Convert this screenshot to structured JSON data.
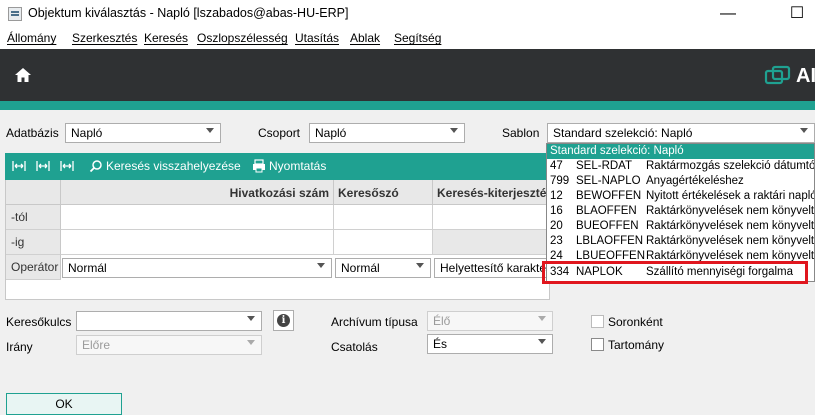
{
  "window": {
    "title": "Objektum kiválasztás - Napló  [lszabados@abas-HU-ERP]",
    "minimize": "—",
    "maximize": "☐"
  },
  "menu": [
    "Állomány",
    "Szerkesztés",
    "Keresés",
    "Oszlopszélesség",
    "Utasítás",
    "Ablak",
    "Segítség"
  ],
  "brand": {
    "text": "AI",
    "accent": "#1fa191"
  },
  "form": {
    "adatbazis_label": "Adatbázis",
    "adatbazis_value": "Napló",
    "csoport_label": "Csoport",
    "csoport_value": "Napló",
    "sablon_label": "Sablon",
    "sablon_value": "Standard szelekció: Napló"
  },
  "toolbar": {
    "search_reset": "Keresés visszahelyezése",
    "print": "Nyomtatás"
  },
  "grid": {
    "headers": [
      "Hivatkozási szám",
      "Keresőszó",
      "Keresés-kiterjeszté"
    ],
    "rows": [
      "-tól",
      "-ig",
      "Operátor"
    ],
    "operators": [
      "Normál",
      "Normál",
      "Helyettesítő karakte"
    ]
  },
  "dropdown": {
    "selected": "Standard szelekció: Napló",
    "items": [
      {
        "num": "47",
        "code": "SEL-RDAT",
        "desc": "Raktármozgás szelekció dátumtól"
      },
      {
        "num": "799",
        "code": "SEL-NAPLO",
        "desc": "Anyagértékeléshez"
      },
      {
        "num": "12",
        "code": "BEWOFFEN",
        "desc": "Nyitott értékelések a raktári napló"
      },
      {
        "num": "16",
        "code": "BLAOFFEN",
        "desc": "Raktárkönyvelések nem könyvelt"
      },
      {
        "num": "20",
        "code": "BUEOFFEN",
        "desc": "Raktárkönyvelések nem könyvelt"
      },
      {
        "num": "23",
        "code": "LBLAOFFEN",
        "desc": "Raktárkönyvelések nem könyvelt"
      },
      {
        "num": "24",
        "code": "LBUEOFFEN",
        "desc": "Raktárkönyvelések nem könyvelt"
      },
      {
        "num": "334",
        "code": "NAPLOK",
        "desc": "Szállító mennyiségi forgalma"
      }
    ]
  },
  "lower": {
    "kereso_label": "Keresőkulcs",
    "kereso_value": "",
    "irany_label": "Irány",
    "irany_value": "Előre",
    "archiv_label": "Archívum típusa",
    "archiv_value": "Élő",
    "csatolas_label": "Csatolás",
    "csatolas_value": "És",
    "soronkent_label": "Soronként",
    "tartomany_label": "Tartomány",
    "ok_label": "OK"
  },
  "colors": {
    "teal": "#1fa191",
    "header_dark": "#2f3133",
    "highlight_red": "#e0161e"
  }
}
